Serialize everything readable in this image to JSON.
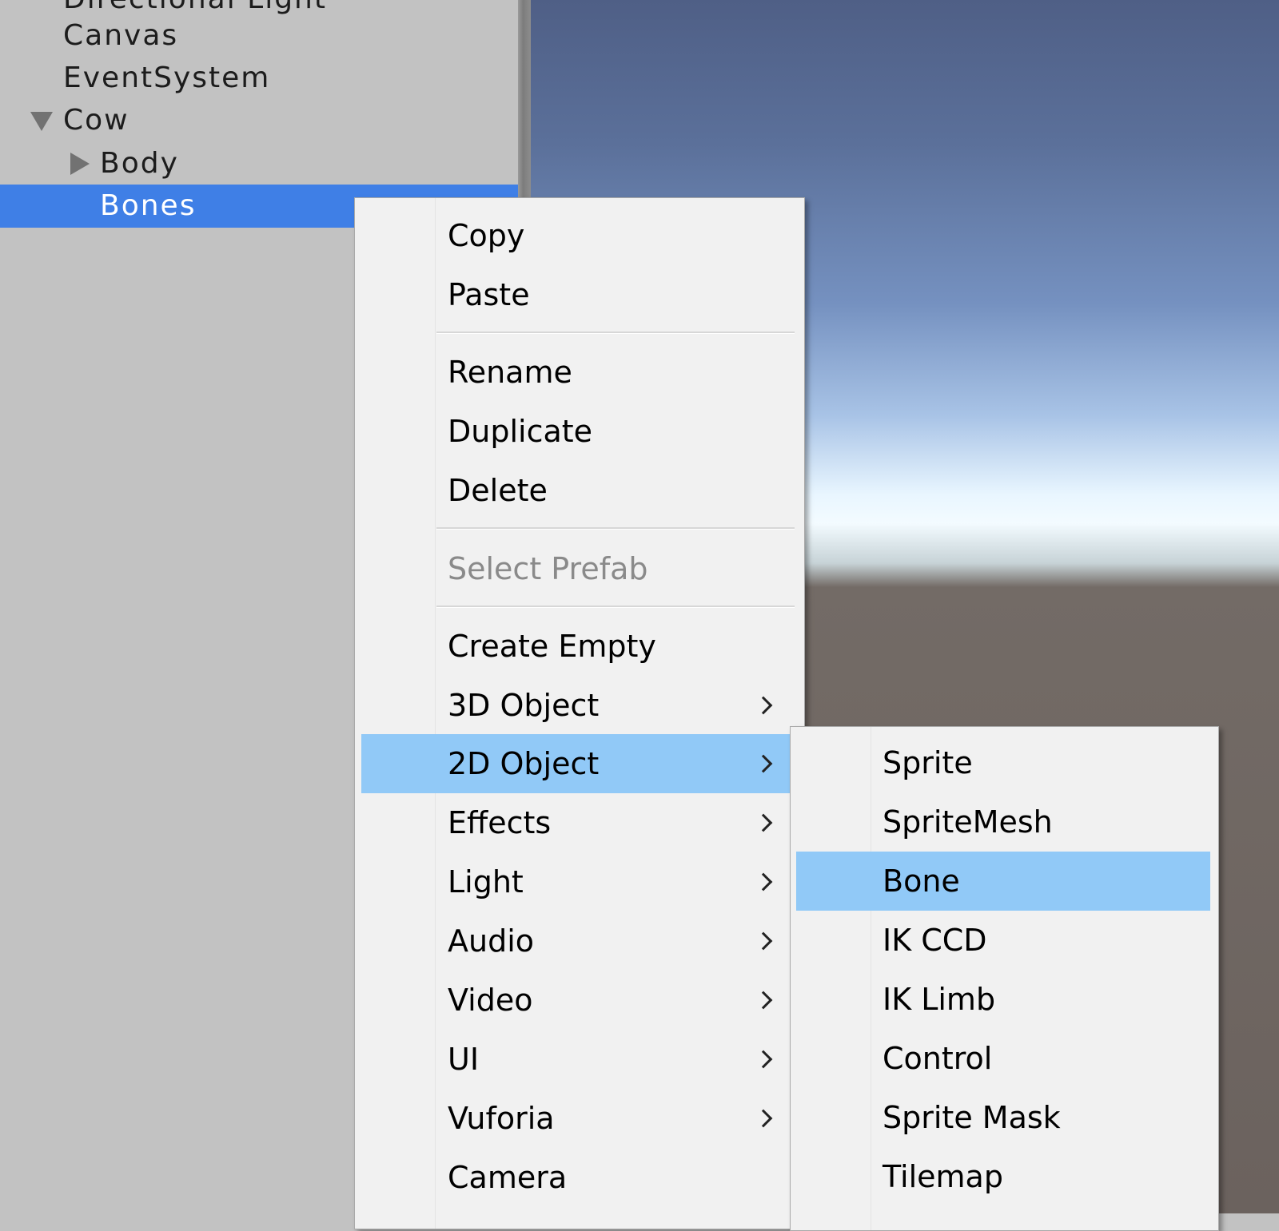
{
  "hierarchy": {
    "items": [
      {
        "label": "Directional Light"
      },
      {
        "label": "Canvas"
      },
      {
        "label": "EventSystem"
      },
      {
        "label": "Cow",
        "expanded": true
      },
      {
        "label": "Body",
        "expanded": false
      },
      {
        "label": "Bones",
        "selected": true
      }
    ]
  },
  "context_menu": {
    "items": [
      {
        "label": "Copy"
      },
      {
        "label": "Paste"
      },
      {
        "label": "Rename"
      },
      {
        "label": "Duplicate"
      },
      {
        "label": "Delete"
      },
      {
        "label": "Select Prefab",
        "disabled": true
      },
      {
        "label": "Create Empty"
      },
      {
        "label": "3D Object",
        "submenu": true
      },
      {
        "label": "2D Object",
        "submenu": true,
        "highlighted": true
      },
      {
        "label": "Effects",
        "submenu": true
      },
      {
        "label": "Light",
        "submenu": true
      },
      {
        "label": "Audio",
        "submenu": true
      },
      {
        "label": "Video",
        "submenu": true
      },
      {
        "label": "UI",
        "submenu": true
      },
      {
        "label": "Vuforia",
        "submenu": true
      },
      {
        "label": "Camera"
      }
    ]
  },
  "submenu_2d_object": {
    "items": [
      {
        "label": "Sprite"
      },
      {
        "label": "SpriteMesh"
      },
      {
        "label": "Bone",
        "highlighted": true
      },
      {
        "label": "IK CCD"
      },
      {
        "label": "IK Limb"
      },
      {
        "label": "Control"
      },
      {
        "label": "Sprite Mask"
      },
      {
        "label": "Tilemap"
      }
    ]
  },
  "colors": {
    "selection_blue": "#3f7fe6",
    "menu_highlight": "#91c9f7",
    "menu_background": "#f1f1f1",
    "panel_background": "#c2c2c2"
  },
  "icons": {
    "expanded": "triangle-down-icon",
    "collapsed": "triangle-right-icon",
    "submenu": "chevron-right-icon"
  }
}
